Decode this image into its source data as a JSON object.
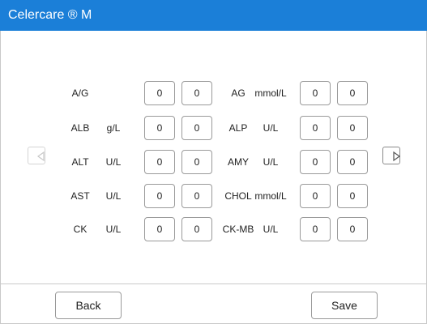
{
  "app": {
    "title": "Celercare ® M"
  },
  "tests": [
    {
      "left": {
        "name": "A/G",
        "unit": "",
        "low": "0",
        "high": "0"
      },
      "right": {
        "name": "AG",
        "unit": "mmol/L",
        "low": "0",
        "high": "0"
      }
    },
    {
      "left": {
        "name": "ALB",
        "unit": "g/L",
        "low": "0",
        "high": "0"
      },
      "right": {
        "name": "ALP",
        "unit": "U/L",
        "low": "0",
        "high": "0"
      }
    },
    {
      "left": {
        "name": "ALT",
        "unit": "U/L",
        "low": "0",
        "high": "0"
      },
      "right": {
        "name": "AMY",
        "unit": "U/L",
        "low": "0",
        "high": "0"
      }
    },
    {
      "left": {
        "name": "AST",
        "unit": "U/L",
        "low": "0",
        "high": "0"
      },
      "right": {
        "name": "CHOL",
        "unit": "mmol/L",
        "low": "0",
        "high": "0"
      }
    },
    {
      "left": {
        "name": "CK",
        "unit": "U/L",
        "low": "0",
        "high": "0"
      },
      "right": {
        "name": "CK-MB",
        "unit": "U/L",
        "low": "0",
        "high": "0"
      }
    }
  ],
  "nav": {
    "prev_icon": "triangle-left-icon",
    "next_icon": "triangle-right-icon",
    "prev_color": "#c8c8c8",
    "next_color": "#555555"
  },
  "footer": {
    "back_label": "Back",
    "save_label": "Save"
  },
  "colors": {
    "titlebar": "#1b7fd8"
  }
}
